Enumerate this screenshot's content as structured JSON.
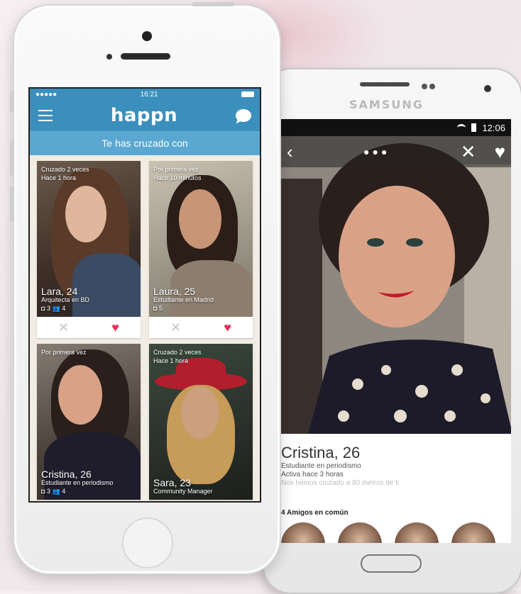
{
  "iphone": {
    "status": {
      "carrier_dots": "●●●●●",
      "time": "16:21"
    },
    "header": {
      "logo": "happn"
    },
    "banner": "Te has cruzado con",
    "cards": [
      {
        "crossed": "Cruzado 2 veces",
        "subtitle": "Hace 1 hora",
        "name": "Lara, 24",
        "job": "Arquitecta en BD",
        "photos": "3",
        "friends": "4"
      },
      {
        "crossed": "Por primera vez",
        "subtitle": "Hace 10 minutos",
        "name": "Laura, 25",
        "job": "Estudiante en Madrid",
        "photos": "5",
        "friends": ""
      },
      {
        "crossed": "Por primera vez",
        "subtitle": "",
        "name": "Cristina, 26",
        "job": "Estudiante en periodismo",
        "photos": "3",
        "friends": "4"
      },
      {
        "crossed": "Cruzado 2 veces",
        "subtitle": "Hace 1 hora",
        "name": "Sara, 23",
        "job": "Community Manager",
        "photos": "",
        "friends": ""
      }
    ]
  },
  "samsung": {
    "brand": "SAMSUNG",
    "status": {
      "time": "12:06"
    },
    "profile": {
      "name": "Cristina, 26",
      "line1": "Estudiante en periodismo",
      "line2": "Activa hace 3 horas",
      "line3": "Nos hemos cruzado a 80 metros de ti",
      "friends_label": "4 Amigos en común"
    }
  },
  "colors": {
    "accent": "#3b8fbd",
    "heart": "#e0345b"
  }
}
